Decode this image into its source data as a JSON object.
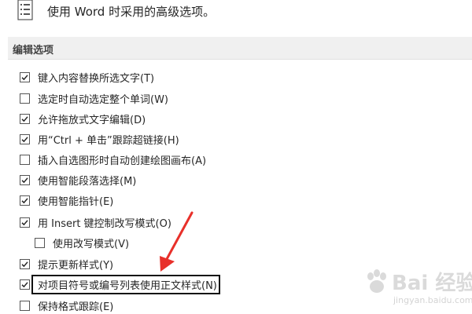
{
  "header": {
    "text": "使用 Word 时采用的高级选项。",
    "icon": "document-list-icon"
  },
  "section": {
    "title": "编辑选项"
  },
  "options": [
    {
      "label": "键入内容替换所选文字(T)",
      "checked": true
    },
    {
      "label": "选定时自动选定整个单词(W)",
      "checked": false
    },
    {
      "label": "允许拖放式文字编辑(D)",
      "checked": true
    },
    {
      "label": "用“Ctrl + 单击”跟踪超链接(H)",
      "checked": true
    },
    {
      "label": "插入自选图形时自动创建绘图画布(A)",
      "checked": false
    },
    {
      "label": "使用智能段落选择(M)",
      "checked": true
    },
    {
      "label": "使用智能指针(E)",
      "checked": true
    },
    {
      "label": "用 Insert 键控制改写模式(O)",
      "checked": true
    },
    {
      "label": "使用改写模式(V)",
      "checked": false
    },
    {
      "label": "提示更新样式(Y)",
      "checked": true
    },
    {
      "label": "对项目符号或编号列表使用正文样式(N)",
      "checked": true
    },
    {
      "label": "保持格式跟踪(E)",
      "checked": false
    }
  ],
  "annotation": {
    "arrow_color": "#e8302a",
    "box_color": "#111111"
  },
  "watermark": {
    "brand": "Bai 经验",
    "url": "jingyan.baidu.com"
  }
}
